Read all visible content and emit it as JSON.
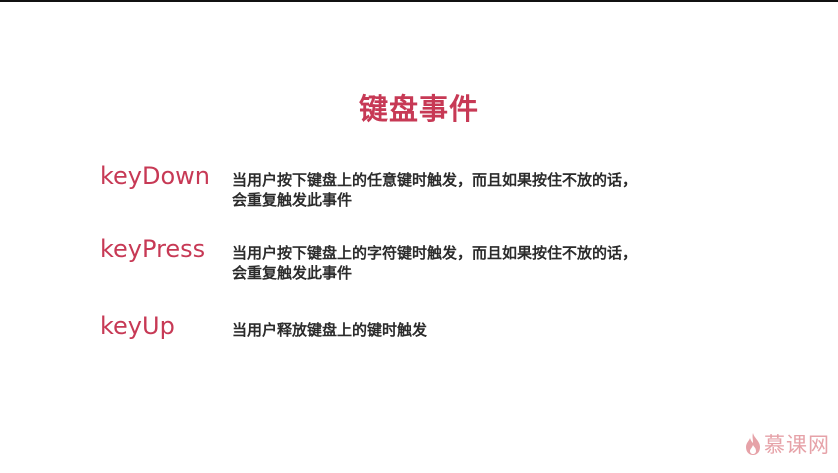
{
  "slide": {
    "title": "键盘事件",
    "events": [
      {
        "name": "keyDown",
        "desc_line1": "当用户按下键盘上的任意键时触发，而且如果按住不放的话，",
        "desc_line2": "会重复触发此事件"
      },
      {
        "name": "keyPress",
        "desc_line1": "当用户按下键盘上的字符键时触发，而且如果按住不放的话，",
        "desc_line2": "会重复触发此事件"
      },
      {
        "name": "keyUp",
        "desc_line1": "当用户释放键盘上的键时触发"
      }
    ]
  },
  "logo": {
    "text": "慕课网",
    "icon": "flame-icon"
  },
  "colors": {
    "accent": "#c73955",
    "body_text": "#2b2b2b",
    "logo": "#e6a2a8",
    "top_border": "#111111"
  }
}
